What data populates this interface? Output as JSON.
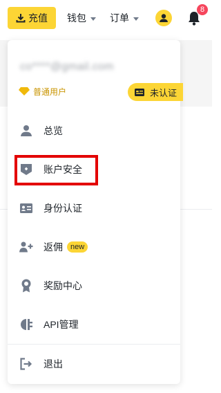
{
  "topbar": {
    "recharge_label": "充值",
    "wallet_label": "钱包",
    "orders_label": "订单",
    "notification_count": "8"
  },
  "account": {
    "email": "co****@gmail.com",
    "level_label": "普通用户",
    "verify_label": "未认证"
  },
  "menu": {
    "items": [
      {
        "label": "总览",
        "icon": "user-icon"
      },
      {
        "label": "账户安全",
        "icon": "shield-icon"
      },
      {
        "label": "身份认证",
        "icon": "id-card-icon"
      },
      {
        "label": "返佣",
        "icon": "add-user-icon",
        "badge": "new"
      },
      {
        "label": "奖励中心",
        "icon": "medal-icon"
      },
      {
        "label": "API管理",
        "icon": "api-icon"
      },
      {
        "label": "退出",
        "icon": "logout-icon"
      }
    ]
  },
  "colors": {
    "accent": "#fcd535",
    "gold_text": "#c99400",
    "badge_red": "#f6465d",
    "highlight_red": "#e30000",
    "icon_gray": "#707a8a"
  }
}
